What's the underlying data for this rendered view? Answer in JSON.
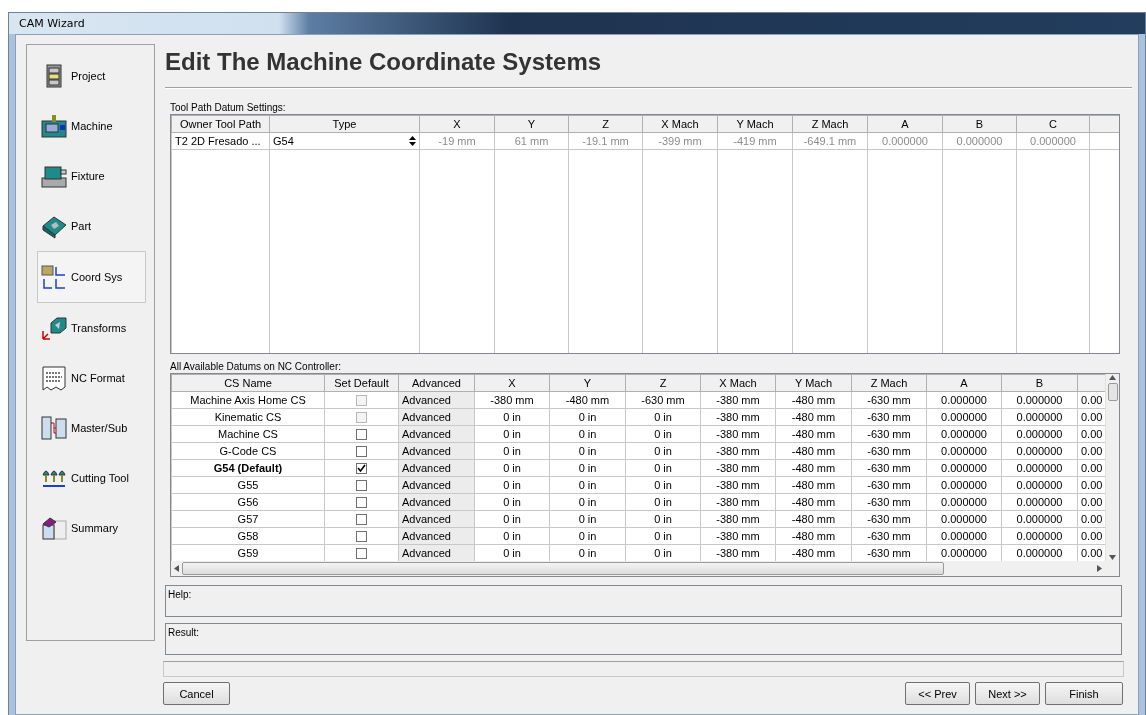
{
  "window": {
    "title": "CAM Wizard"
  },
  "sidebar": {
    "items": [
      {
        "label": "Project",
        "selected": false
      },
      {
        "label": "Machine",
        "selected": false
      },
      {
        "label": "Fixture",
        "selected": false
      },
      {
        "label": "Part",
        "selected": false
      },
      {
        "label": "Coord Sys",
        "selected": true
      },
      {
        "label": "Transforms",
        "selected": false
      },
      {
        "label": "NC Format",
        "selected": false
      },
      {
        "label": "Master/Sub",
        "selected": false
      },
      {
        "label": "Cutting Tool",
        "selected": false
      },
      {
        "label": "Summary",
        "selected": false
      }
    ]
  },
  "heading": "Edit The Machine Coordinate Systems",
  "tool_path_table": {
    "label": "Tool Path Datum Settings:",
    "columns": [
      {
        "label": "Owner Tool Path",
        "editable": true
      },
      {
        "label": "Type",
        "editable": true
      },
      {
        "label": "X",
        "editable": false
      },
      {
        "label": "Y",
        "editable": false
      },
      {
        "label": "Z",
        "editable": false
      },
      {
        "label": "X Mach",
        "editable": false
      },
      {
        "label": "Y Mach",
        "editable": false
      },
      {
        "label": "Z Mach",
        "editable": false
      },
      {
        "label": "A",
        "editable": false
      },
      {
        "label": "B",
        "editable": false
      },
      {
        "label": "C",
        "editable": false
      }
    ],
    "rows": [
      {
        "cells": [
          "T2 2D Fresado ...",
          "G54",
          "-19 mm",
          "61 mm",
          "-19.1 mm",
          "-399 mm",
          "-419 mm",
          "-649.1 mm",
          "0.000000",
          "0.000000",
          "0.000000"
        ]
      }
    ]
  },
  "datum_table": {
    "label": "All Available Datums on NC Controller:",
    "columns": [
      "CS Name",
      "Set Default",
      "Advanced",
      "X",
      "Y",
      "Z",
      "X Mach",
      "Y Mach",
      "Z Mach",
      "A",
      "B"
    ],
    "rows": [
      {
        "name": "Machine Axis Home CS",
        "is_default": false,
        "set_default": {
          "checked": false,
          "disabled": true
        },
        "advanced": "Advanced",
        "values": [
          "-380 mm",
          "-480 mm",
          "-630 mm",
          "-380 mm",
          "-480 mm",
          "-630 mm",
          "0.000000",
          "0.000000",
          "0.00"
        ]
      },
      {
        "name": "Kinematic CS",
        "is_default": false,
        "set_default": {
          "checked": false,
          "disabled": true
        },
        "advanced": "Advanced",
        "values": [
          "0 in",
          "0 in",
          "0 in",
          "-380 mm",
          "-480 mm",
          "-630 mm",
          "0.000000",
          "0.000000",
          "0.00"
        ]
      },
      {
        "name": "Machine CS",
        "is_default": false,
        "set_default": {
          "checked": false,
          "disabled": false
        },
        "advanced": "Advanced",
        "values": [
          "0 in",
          "0 in",
          "0 in",
          "-380 mm",
          "-480 mm",
          "-630 mm",
          "0.000000",
          "0.000000",
          "0.00"
        ]
      },
      {
        "name": "G-Code CS",
        "is_default": false,
        "set_default": {
          "checked": false,
          "disabled": false
        },
        "advanced": "Advanced",
        "values": [
          "0 in",
          "0 in",
          "0 in",
          "-380 mm",
          "-480 mm",
          "-630 mm",
          "0.000000",
          "0.000000",
          "0.00"
        ]
      },
      {
        "name": "G54 (Default)",
        "is_default": true,
        "set_default": {
          "checked": true,
          "disabled": false
        },
        "advanced": "Advanced",
        "values": [
          "0 in",
          "0 in",
          "0 in",
          "-380 mm",
          "-480 mm",
          "-630 mm",
          "0.000000",
          "0.000000",
          "0.00"
        ]
      },
      {
        "name": "G55",
        "is_default": false,
        "set_default": {
          "checked": false,
          "disabled": false
        },
        "advanced": "Advanced",
        "values": [
          "0 in",
          "0 in",
          "0 in",
          "-380 mm",
          "-480 mm",
          "-630 mm",
          "0.000000",
          "0.000000",
          "0.00"
        ]
      },
      {
        "name": "G56",
        "is_default": false,
        "set_default": {
          "checked": false,
          "disabled": false
        },
        "advanced": "Advanced",
        "values": [
          "0 in",
          "0 in",
          "0 in",
          "-380 mm",
          "-480 mm",
          "-630 mm",
          "0.000000",
          "0.000000",
          "0.00"
        ]
      },
      {
        "name": "G57",
        "is_default": false,
        "set_default": {
          "checked": false,
          "disabled": false
        },
        "advanced": "Advanced",
        "values": [
          "0 in",
          "0 in",
          "0 in",
          "-380 mm",
          "-480 mm",
          "-630 mm",
          "0.000000",
          "0.000000",
          "0.00"
        ]
      },
      {
        "name": "G58",
        "is_default": false,
        "set_default": {
          "checked": false,
          "disabled": false
        },
        "advanced": "Advanced",
        "values": [
          "0 in",
          "0 in",
          "0 in",
          "-380 mm",
          "-480 mm",
          "-630 mm",
          "0.000000",
          "0.000000",
          "0.00"
        ]
      },
      {
        "name": "G59",
        "is_default": false,
        "set_default": {
          "checked": false,
          "disabled": false
        },
        "advanced": "Advanced",
        "values": [
          "0 in",
          "0 in",
          "0 in",
          "-380 mm",
          "-480 mm",
          "-630 mm",
          "0.000000",
          "0.000000",
          "0.00"
        ]
      }
    ]
  },
  "help": {
    "label": "Help:"
  },
  "result": {
    "label": "Result:"
  },
  "buttons_left": [
    "Cancel"
  ],
  "buttons_right": [
    "<< Prev",
    "Next >>",
    "Finish"
  ]
}
